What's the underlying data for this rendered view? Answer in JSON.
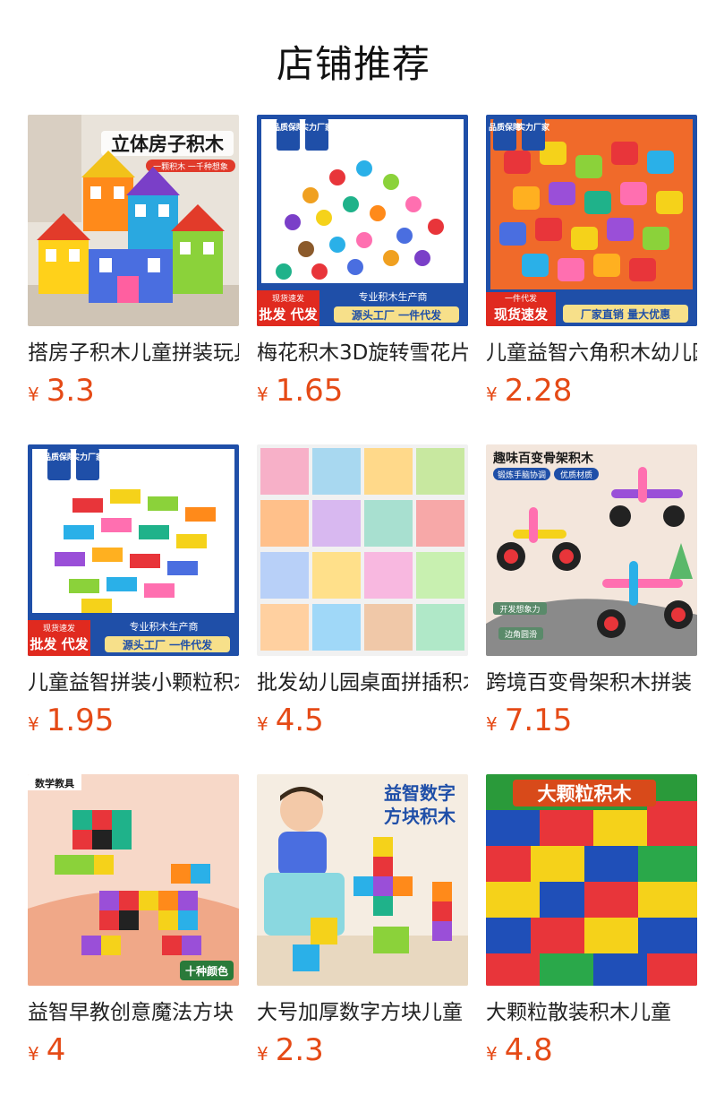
{
  "header": {
    "title": "店铺推荐"
  },
  "products": [
    {
      "name": "搭房子积木儿童拼装玩具",
      "currency": "¥",
      "price": "3.3",
      "banner": {
        "main": "立体房子积木",
        "sub": "一颗积木 一千种想象"
      }
    },
    {
      "name": "梅花积木3D旋转雪花片",
      "currency": "¥",
      "price": "1.65",
      "banner": {
        "badge1": "品质保障",
        "badge2": "实力厂家",
        "strip_small": "现货速发",
        "strip_big": "批发 代发",
        "maker": "专业积木生产商",
        "slogan": "源头工厂 一件代发"
      }
    },
    {
      "name": "儿童益智六角积木幼儿园",
      "currency": "¥",
      "price": "2.28",
      "banner": {
        "badge1": "品质保障",
        "badge2": "实力厂家",
        "strip_small": "一件代发",
        "strip_big": "现货速发",
        "slogan": "厂家直销 量大优惠"
      }
    },
    {
      "name": "儿童益智拼装小颗粒积木",
      "currency": "¥",
      "price": "1.95",
      "banner": {
        "badge1": "品质保障",
        "badge2": "实力厂家",
        "strip_small": "现货速发",
        "strip_big": "批发 代发",
        "maker": "专业积木生产商",
        "slogan": "源头工厂 一件代发"
      }
    },
    {
      "name": "批发幼儿园桌面拼插积木",
      "currency": "¥",
      "price": "4.5",
      "banner": {}
    },
    {
      "name": "跨境百变骨架积木拼装",
      "currency": "¥",
      "price": "7.15",
      "banner": {
        "main": "趣味百变骨架积木",
        "tag1": "锻炼手脑协调",
        "tag2": "优质材质",
        "tag3": "开发想象力",
        "tag4": "边角圆滑"
      }
    },
    {
      "name": "益智早教创意魔法方块",
      "currency": "¥",
      "price": "4",
      "banner": {
        "main": "数学教具",
        "sub": "十种颜色"
      }
    },
    {
      "name": "大号加厚数字方块儿童",
      "currency": "¥",
      "price": "2.3",
      "banner": {
        "main": "益智数字",
        "main2": "方块积木"
      }
    },
    {
      "name": "大颗粒散装积木儿童",
      "currency": "¥",
      "price": "4.8",
      "banner": {
        "main": "大颗粒积木"
      }
    }
  ],
  "colors": {
    "price": "#e54a16",
    "banner_blue": "#1f4fa8",
    "banner_red": "#e02a1f"
  }
}
